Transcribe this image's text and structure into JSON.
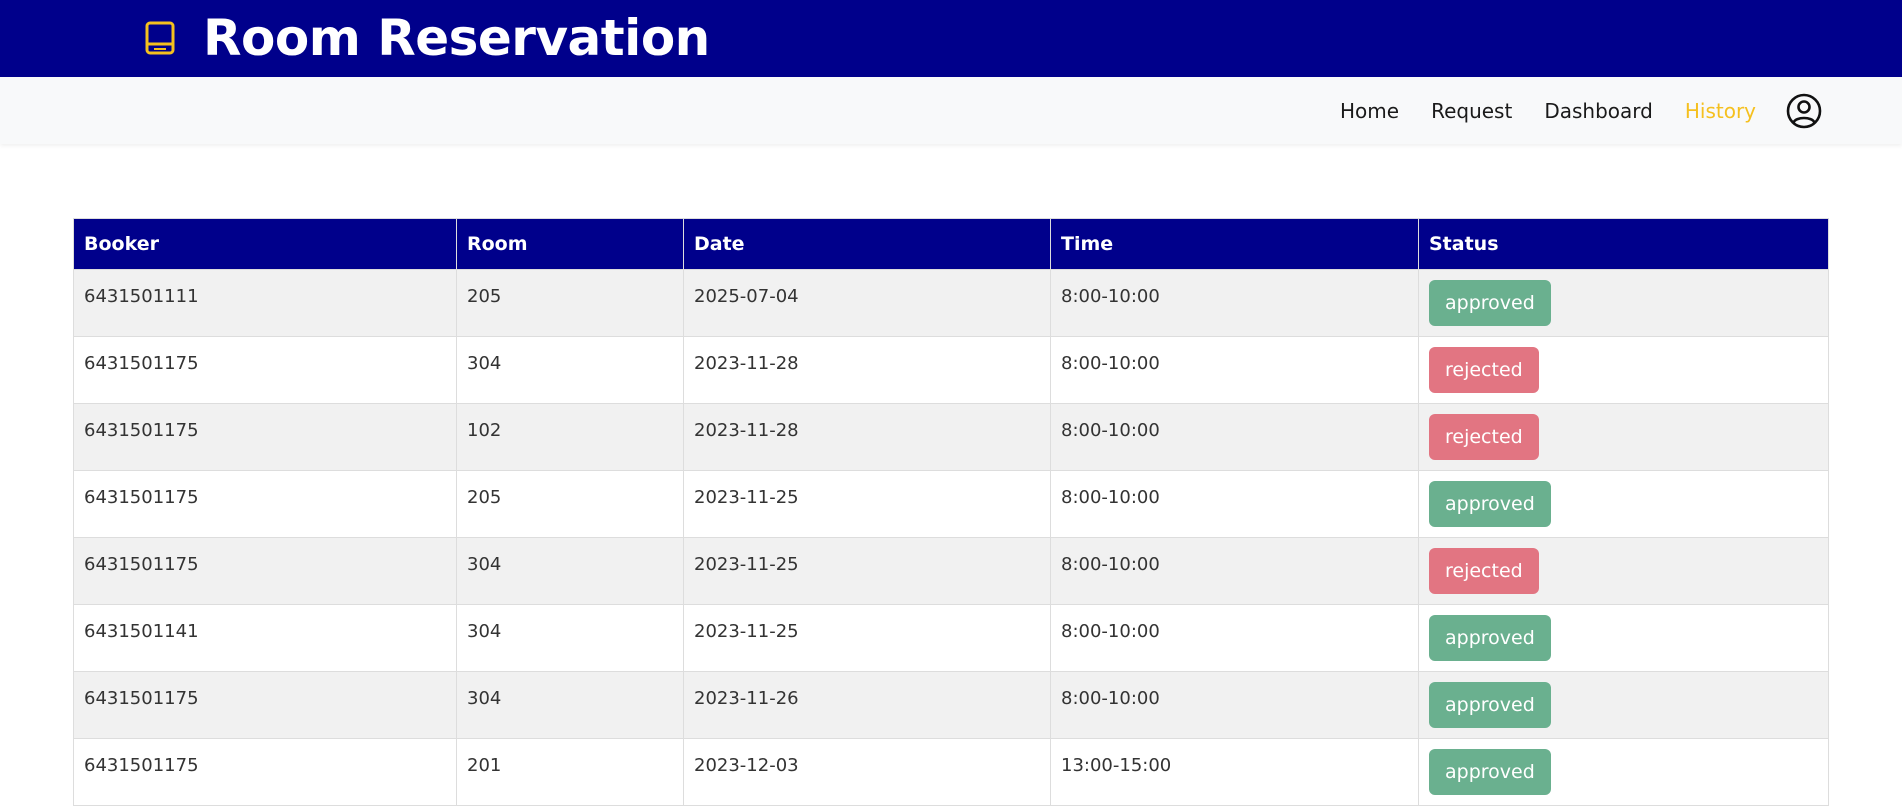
{
  "header": {
    "title": "Room Reservation",
    "logo_icon": "book-icon",
    "background": "#00008b",
    "logo_color": "#f5c01f"
  },
  "nav": {
    "items": [
      {
        "label": "Home",
        "active": false
      },
      {
        "label": "Request",
        "active": false
      },
      {
        "label": "Dashboard",
        "active": false
      },
      {
        "label": "History",
        "active": true
      }
    ],
    "profile_icon": "user-circle-icon",
    "active_color": "#f5c01f"
  },
  "table": {
    "columns": [
      "Booker",
      "Room",
      "Date",
      "Time",
      "Status"
    ],
    "rows": [
      {
        "booker": "6431501111",
        "room": "205",
        "date": "2025-07-04",
        "time": "8:00-10:00",
        "status": "approved"
      },
      {
        "booker": "6431501175",
        "room": "304",
        "date": "2023-11-28",
        "time": "8:00-10:00",
        "status": "rejected"
      },
      {
        "booker": "6431501175",
        "room": "102",
        "date": "2023-11-28",
        "time": "8:00-10:00",
        "status": "rejected"
      },
      {
        "booker": "6431501175",
        "room": "205",
        "date": "2023-11-25",
        "time": "8:00-10:00",
        "status": "approved"
      },
      {
        "booker": "6431501175",
        "room": "304",
        "date": "2023-11-25",
        "time": "8:00-10:00",
        "status": "rejected"
      },
      {
        "booker": "6431501141",
        "room": "304",
        "date": "2023-11-25",
        "time": "8:00-10:00",
        "status": "approved"
      },
      {
        "booker": "6431501175",
        "room": "304",
        "date": "2023-11-26",
        "time": "8:00-10:00",
        "status": "approved"
      },
      {
        "booker": "6431501175",
        "room": "201",
        "date": "2023-12-03",
        "time": "13:00-15:00",
        "status": "approved"
      }
    ],
    "status_colors": {
      "approved": "#6ab08f",
      "rejected": "#e27582"
    }
  }
}
